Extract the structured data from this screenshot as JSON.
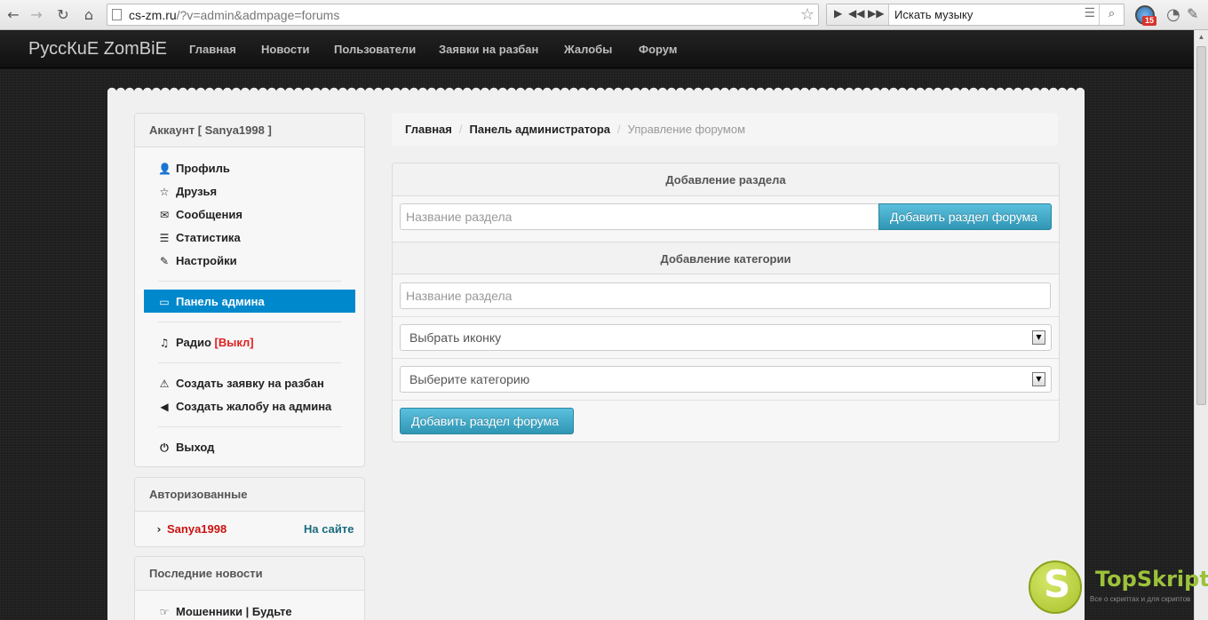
{
  "browser": {
    "url_host": "cs-zm.ru",
    "url_path": "/?v=admin&admpage=forums",
    "music_search_text": "Искать музыку",
    "extension_badge": "15"
  },
  "site": {
    "brand": "РуссКuЕ ZomBiE",
    "nav": [
      "Главная",
      "Новости",
      "Пользователи",
      "Заявки на разбан",
      "Жалобы",
      "Форум"
    ]
  },
  "account_panel": {
    "title": "Аккаунт [ Sanya1998 ]",
    "items": [
      {
        "label": "Профиль",
        "icon": "user-icon"
      },
      {
        "label": "Друзья",
        "icon": "star-icon"
      },
      {
        "label": "Сообщения",
        "icon": "envelope-icon"
      },
      {
        "label": "Статистика",
        "icon": "list-icon"
      },
      {
        "label": "Настройки",
        "icon": "wrench-icon"
      }
    ],
    "admin_panel_label": "Панель админа",
    "radio_label": "Радио",
    "radio_status": "[Выкл]",
    "unban_request_label": "Создать заявку на разбан",
    "complaint_label": "Создать жалобу на админа",
    "logout_label": "Выход"
  },
  "authorized_panel": {
    "title": "Авторизованные",
    "user": "Sanya1998",
    "status": "На сайте"
  },
  "news_panel": {
    "title": "Последние новости",
    "item": "Мошенники | Будьте"
  },
  "breadcrumb": {
    "home": "Главная",
    "admin": "Панель администратора",
    "current": "Управление форумом"
  },
  "form": {
    "section_title": "Добавление раздела",
    "section_name_placeholder": "Название раздела",
    "add_section_button": "Добавить раздел форума",
    "category_title": "Добавление категории",
    "category_name_placeholder": "Название раздела",
    "icon_select": "Выбрать иконку",
    "category_select": "Выберите категорию",
    "add_category_button": "Добавить раздел форума"
  },
  "watermark": {
    "logo_letter": "S",
    "name": "TopSkript",
    "tagline": "Все о скриптах и для скриптов"
  },
  "colors": {
    "accent": "#0088cc",
    "button": "#49afcd",
    "off_status": "#e02020",
    "username": "#cc1111",
    "online": "#1a6a80"
  }
}
